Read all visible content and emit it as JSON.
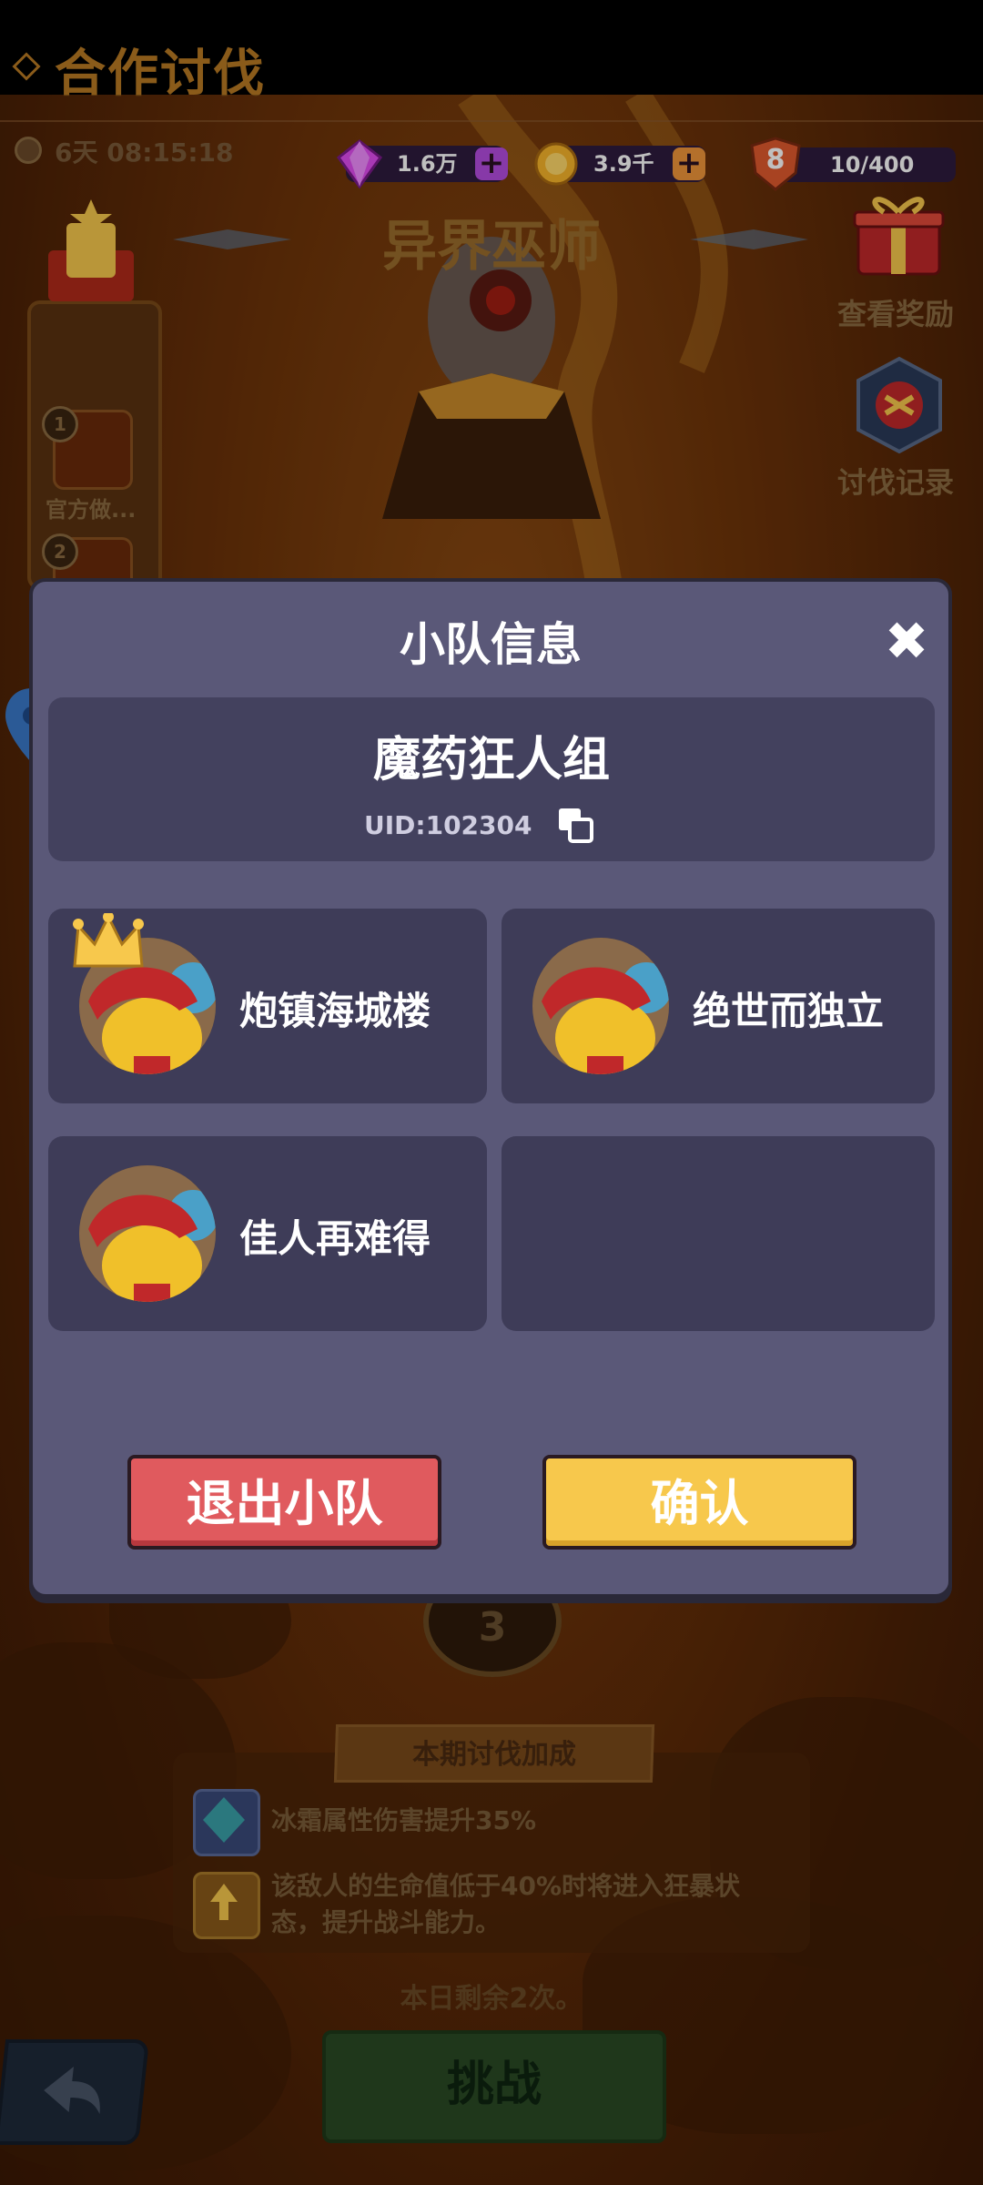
{
  "header": {
    "title": "合作讨伐",
    "gems": "1.6万",
    "coins": "3.9千",
    "level": "8",
    "stamina": "10/400",
    "timer": "6天 08:15:18"
  },
  "boss": {
    "name": "异界巫师"
  },
  "side_buttons": {
    "rewards_label": "查看奖励",
    "records_label": "讨伐记录"
  },
  "ranking": {
    "rank1": "1",
    "rank2": "2",
    "rank1_name": "官方做..."
  },
  "stage": {
    "number": "3"
  },
  "bonus": {
    "header": "本期讨伐加成",
    "items": [
      "冰霜属性伤害提升35%",
      "该敌人的生命值低于40%时将进入狂暴状态，提升战斗能力。"
    ]
  },
  "remaining_text": "本日剩余2次。",
  "challenge_label": "挑战",
  "modal": {
    "title": "小队信息",
    "close": "✖",
    "team_name": "魔药狂人组",
    "uid": "UID:102304",
    "members": [
      {
        "name": "炮镇海城楼",
        "leader": true
      },
      {
        "name": "绝世而独立",
        "leader": false
      },
      {
        "name": "佳人再难得",
        "leader": false
      }
    ],
    "leave_label": "退出小队",
    "confirm_label": "确认"
  },
  "colors": {
    "modal_bg": "#5a5878",
    "card_bg": "#3e3c58",
    "leave_button": "#e05a5e",
    "confirm_button": "#f7c84c"
  }
}
